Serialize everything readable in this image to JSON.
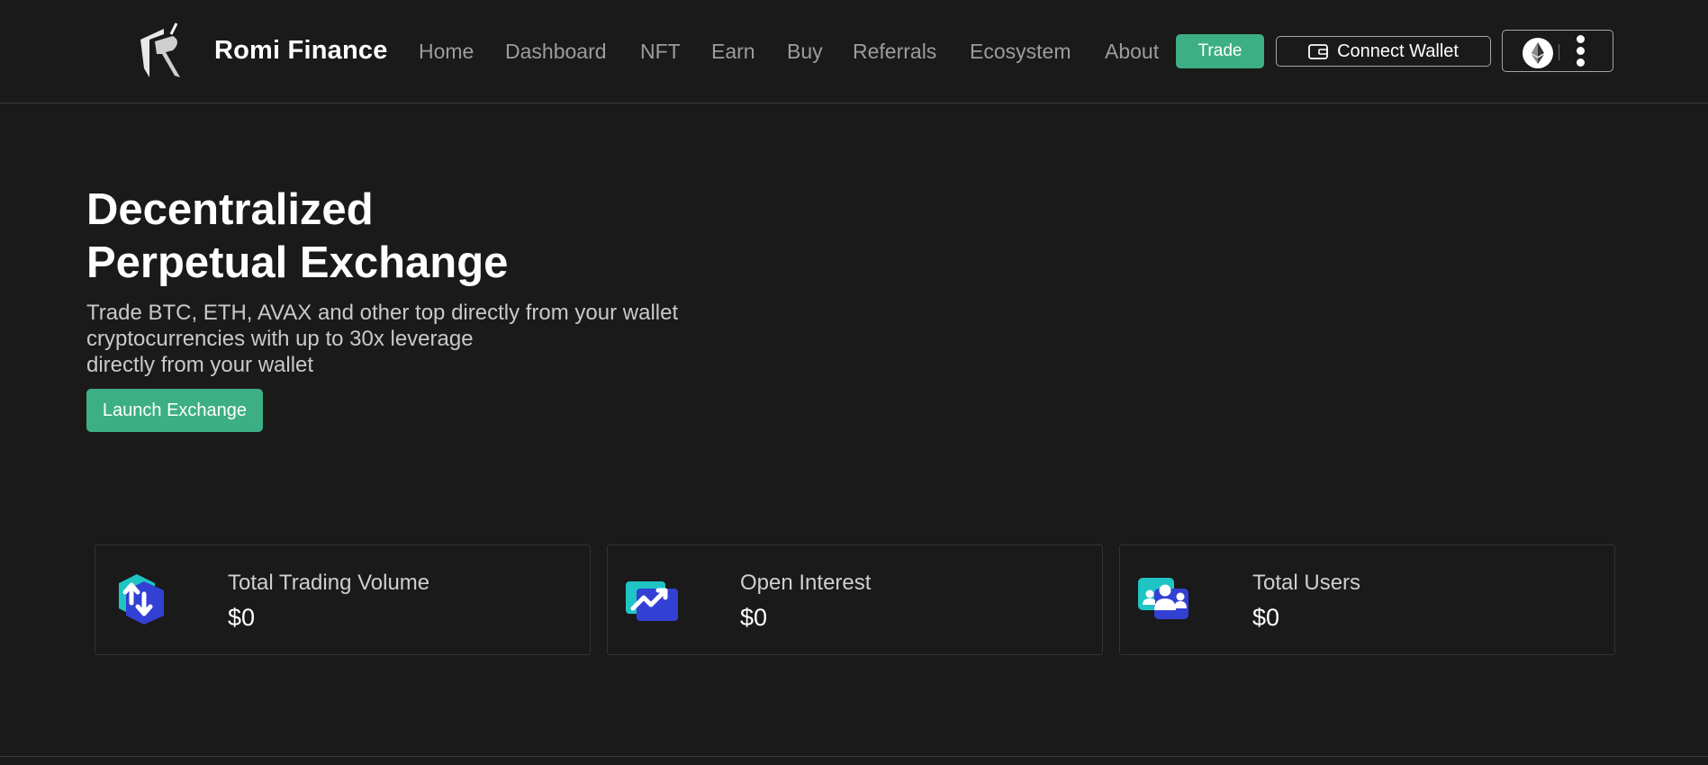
{
  "header": {
    "brand": "Romi Finance",
    "logo_icon": "romi-logo-icon",
    "nav": [
      "Home",
      "Dashboard",
      "NFT",
      "Earn",
      "Buy",
      "Referrals",
      "Ecosystem",
      "About"
    ],
    "trade_label": "Trade",
    "connect_wallet_label": "Connect Wallet",
    "wallet_icon": "wallet-icon",
    "network_icon": "ethereum-icon",
    "more_icon": "vertical-dots-icon"
  },
  "hero": {
    "title_line1": "Decentralized",
    "title_line2": "Perpetual Exchange",
    "desc_line1": "Trade BTC, ETH, AVAX and other top directly from your wallet",
    "desc_line2": "cryptocurrencies with up to 30x leverage",
    "desc_line3": "directly from your wallet",
    "launch_label": "Launch Exchange"
  },
  "stats": [
    {
      "label": "Total Trading Volume",
      "value": "$0",
      "icon": "trading-volume-icon"
    },
    {
      "label": "Open Interest",
      "value": "$0",
      "icon": "open-interest-icon"
    },
    {
      "label": "Total Users",
      "value": "$0",
      "icon": "users-icon"
    }
  ],
  "colors": {
    "background": "#1a1a1a",
    "accent_green": "#3daf84",
    "icon_teal": "#1fc4c4",
    "icon_blue": "#3340d4"
  }
}
